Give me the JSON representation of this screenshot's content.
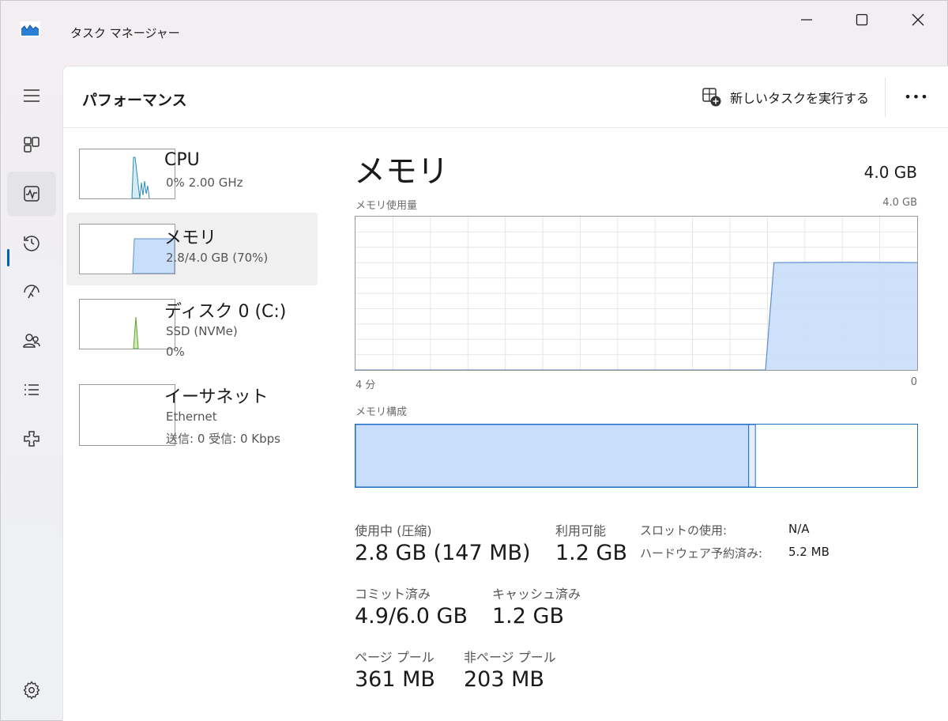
{
  "window": {
    "title": "タスク マネージャー",
    "app_icon": "task-manager-icon"
  },
  "nav": {
    "items": [
      {
        "name": "hamburger-menu-icon"
      },
      {
        "name": "processes-icon"
      },
      {
        "name": "performance-icon",
        "active": true
      },
      {
        "name": "app-history-icon"
      },
      {
        "name": "startup-apps-icon"
      },
      {
        "name": "users-icon"
      },
      {
        "name": "details-icon"
      },
      {
        "name": "services-icon"
      },
      {
        "name": "settings-icon"
      }
    ]
  },
  "header": {
    "page_title": "パフォーマンス",
    "run_task_label": "新しいタスクを実行する",
    "more_label": "•••"
  },
  "resources": [
    {
      "id": "cpu",
      "name": "CPU",
      "sub1": "0%  2.00 GHz",
      "sub2": ""
    },
    {
      "id": "memory",
      "name": "メモリ",
      "sub1": "2.8/4.0 GB (70%)",
      "sub2": "",
      "selected": true
    },
    {
      "id": "disk",
      "name": "ディスク 0 (C:)",
      "sub1": "SSD (NVMe)",
      "sub2": "0%"
    },
    {
      "id": "ethernet",
      "name": "イーサネット",
      "sub1": "Ethernet",
      "sub2": "送信: 0 受信: 0 Kbps"
    }
  ],
  "detail": {
    "title": "メモリ",
    "total": "4.0 GB",
    "usage_label": "メモリ使用量",
    "usage_max": "4.0 GB",
    "x_left": "4 分",
    "x_right": "0",
    "composition_label": "メモリ構成",
    "stats": {
      "in_use_label": "使用中 (圧縮)",
      "in_use_value": "2.8 GB (147 MB)",
      "available_label": "利用可能",
      "available_value": "1.2 GB",
      "committed_label": "コミット済み",
      "committed_value": "4.9/6.0 GB",
      "cached_label": "キャッシュ済み",
      "cached_value": "1.2 GB",
      "paged_label": "ページ プール",
      "paged_value": "361 MB",
      "nonpaged_label": "非ページ プール",
      "nonpaged_value": "203 MB",
      "slots_label": "スロットの使用:",
      "slots_value": "N/A",
      "hw_reserved_label": "ハードウェア予約済み:",
      "hw_reserved_value": "5.2 MB"
    }
  },
  "colors": {
    "accent": "#005fb8",
    "memory_fill": "#c9defb",
    "memory_line": "#5d8fd6",
    "cpu_line": "#2a8bb6",
    "disk_line": "#5aa52a",
    "disk_fill": "#cfeab3",
    "grid": "#e6e6e6"
  },
  "chart_data": {
    "type": "area",
    "title": "メモリ使用量",
    "xlabel": "",
    "ylabel": "",
    "x_range_label": [
      "4 分",
      "0"
    ],
    "ylim": [
      0,
      4.0
    ],
    "y_unit": "GB",
    "x": [
      0,
      0.73,
      0.745,
      0.88,
      1.0
    ],
    "values": [
      0,
      0,
      2.8,
      2.81,
      2.8
    ],
    "composition": {
      "in_use_fraction": 0.7,
      "modified_fraction": 0.012,
      "standby_fraction": 0.0,
      "free_fraction": 0.288
    }
  }
}
